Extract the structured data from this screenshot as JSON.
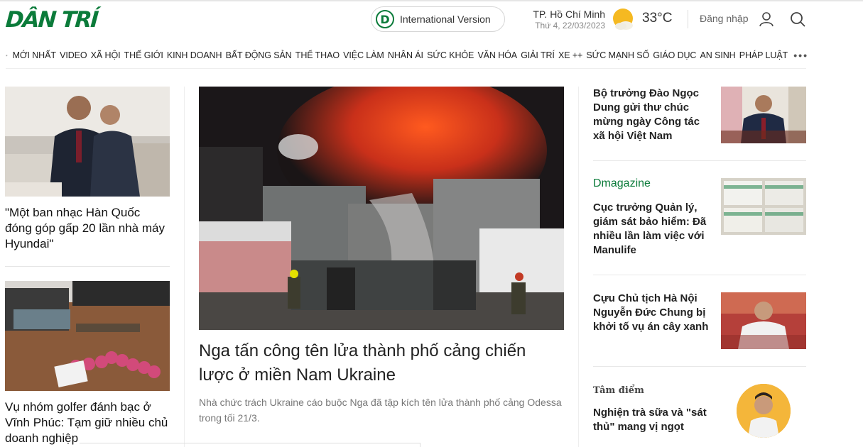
{
  "header": {
    "logo": "DÂN TRÍ",
    "intl_button": "International Version",
    "intl_badge": "D",
    "weather": {
      "city": "TP. Hồ Chí Minh",
      "date": "Thứ 4, 22/03/2023",
      "temp": "33°C"
    },
    "login": "Đăng nhập"
  },
  "nav": {
    "items": [
      "MỚI NHẤT",
      "VIDEO",
      "XÃ HỘI",
      "THẾ GIỚI",
      "KINH DOANH",
      "BẤT ĐỘNG SẢN",
      "THỂ THAO",
      "VIỆC LÀM",
      "NHÂN ÁI",
      "SỨC KHỎE",
      "VĂN HÓA",
      "GIẢI TRÍ",
      "XE ++",
      "SỨC MẠNH SỐ",
      "GIÁO DỤC",
      "AN SINH",
      "PHÁP LUẬT"
    ],
    "more": "•••"
  },
  "left": {
    "articles": [
      {
        "title": "\"Một ban nhạc Hàn Quốc đóng góp gấp 20 lần nhà máy Hyundai\""
      },
      {
        "title": "Vụ nhóm golfer đánh bạc ở Vĩnh Phúc: Tạm giữ nhiều chủ doanh nghiệp"
      }
    ]
  },
  "main": {
    "title": "Nga tấn công tên lửa thành phố cảng chiến lược ở miền Nam Ukraine",
    "description": "Nhà chức trách Ukraine cáo buộc Nga đã tập kích tên lửa thành phố cảng Odessa trong tối 21/3."
  },
  "right": {
    "articles": [
      {
        "title": "Bộ trưởng Đào Ngọc Dung gửi thư chúc mừng ngày Công tác xã hội Việt Nam"
      },
      {
        "kicker": "Dmagazine",
        "title": "Cục trưởng Quản lý, giám sát bảo hiểm: Đã nhiều lần làm việc với Manulife"
      },
      {
        "title": "Cựu Chủ tịch Hà Nội Nguyễn Đức Chung bị khởi tố vụ án cây xanh"
      },
      {
        "kicker": "Tâm điểm",
        "title": "Nghiện trà sữa và \"sát thủ\" mang vị ngọt"
      }
    ]
  },
  "colors": {
    "brand": "#0b7b3a",
    "sun": "#f5b921"
  },
  "icons": [
    "home-icon",
    "user-icon",
    "search-icon",
    "sun-cloud-icon"
  ]
}
